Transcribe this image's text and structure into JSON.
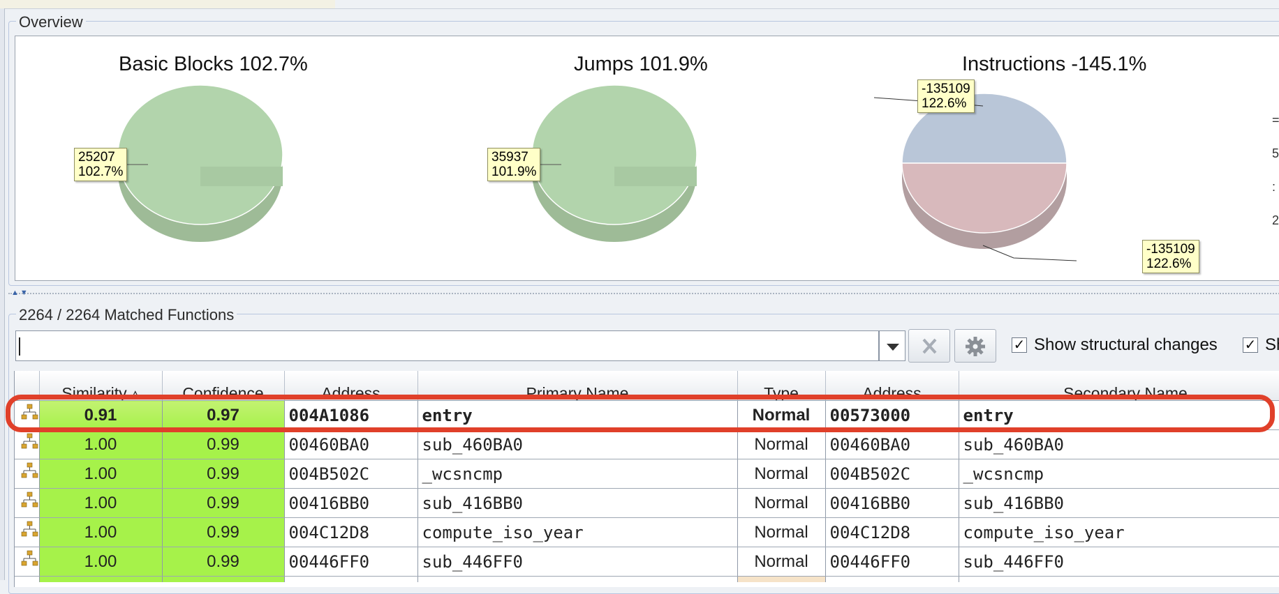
{
  "overview": {
    "title": "Overview",
    "charts": [
      {
        "title": "Basic Blocks 102.7%",
        "labels": [
          {
            "line1": "25207",
            "line2": "102.7%"
          }
        ]
      },
      {
        "title": "Jumps 101.9%",
        "labels": [
          {
            "line1": "35937",
            "line2": "101.9%"
          }
        ]
      },
      {
        "title": "Instructions -145.1%",
        "labels": [
          {
            "line1": "-135109",
            "line2": "122.6%"
          },
          {
            "line1": "-135109",
            "line2": "122.6%"
          }
        ]
      }
    ],
    "right_axis_chars": [
      "=",
      "5",
      ":",
      "2"
    ]
  },
  "chart_data": [
    {
      "type": "pie",
      "title": "Basic Blocks 102.7%",
      "slices": [
        {
          "value": 25207,
          "percent": 102.7,
          "color": "#b2d4ac"
        }
      ]
    },
    {
      "type": "pie",
      "title": "Jumps 101.9%",
      "slices": [
        {
          "value": 35937,
          "percent": 101.9,
          "color": "#b2d4ac"
        }
      ]
    },
    {
      "type": "pie",
      "title": "Instructions -145.1%",
      "slices": [
        {
          "value": -135109,
          "percent": 122.6,
          "color": "#b9c6d8"
        },
        {
          "value": -135109,
          "percent": 122.6,
          "color": "#d8b9bc"
        }
      ]
    }
  ],
  "matched": {
    "title": "2264 / 2264 Matched Functions",
    "search": {
      "value": "",
      "placeholder": ""
    },
    "options": [
      {
        "label": "Show structural changes",
        "checked": true
      },
      {
        "label": "Sh",
        "checked": true
      }
    ],
    "columns": [
      "Similarity ▵",
      "Confidence",
      "Address",
      "Primary Name",
      "Type",
      "Address",
      "Secondary Name"
    ],
    "rows": [
      [
        "0.91",
        "0.97",
        "004A1086",
        "entry",
        "Normal",
        "00573000",
        "entry"
      ],
      [
        "1.00",
        "0.99",
        "00460BA0",
        "sub_460BA0",
        "Normal",
        "00460BA0",
        "sub_460BA0"
      ],
      [
        "1.00",
        "0.99",
        "004B502C",
        "_wcsncmp",
        "Normal",
        "004B502C",
        "_wcsncmp"
      ],
      [
        "1.00",
        "0.99",
        "00416BB0",
        "sub_416BB0",
        "Normal",
        "00416BB0",
        "sub_416BB0"
      ],
      [
        "1.00",
        "0.99",
        "004C12D8",
        "compute_iso_year",
        "Normal",
        "004C12D8",
        "compute_iso_year"
      ],
      [
        "1.00",
        "0.99",
        "00446FF0",
        "sub_446FF0",
        "Normal",
        "00446FF0",
        "sub_446FF0"
      ]
    ]
  },
  "colors": {
    "accent_highlight": "#e0402a",
    "similarity_green": "#a6f24a",
    "pie_green": "#b2d4ac",
    "pie_blue": "#b9c6d8",
    "pie_red": "#d8b9bc"
  }
}
